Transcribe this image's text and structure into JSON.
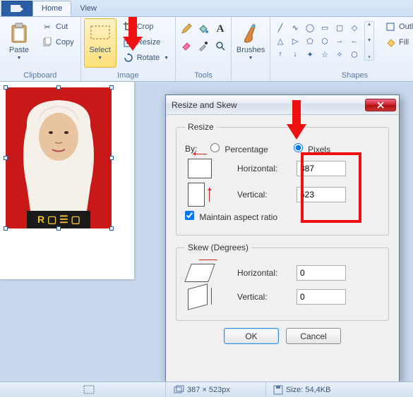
{
  "tabs": {
    "home": "Home",
    "view": "View"
  },
  "ribbon": {
    "clipboard": {
      "label": "Clipboard",
      "paste": "Paste",
      "cut": "Cut",
      "copy": "Copy"
    },
    "image": {
      "label": "Image",
      "select": "Select",
      "crop": "Crop",
      "resize": "Resize",
      "rotate": "Rotate"
    },
    "tools": {
      "label": "Tools"
    },
    "brushes": {
      "label": "Brushes"
    },
    "shapes": {
      "label": "Shapes",
      "outline": "Outline",
      "fill": "Fill"
    }
  },
  "dialog": {
    "title": "Resize and Skew",
    "resize_legend": "Resize",
    "by": "By:",
    "percentage": "Percentage",
    "pixels": "Pixels",
    "horizontal": "Horizontal:",
    "vertical": "Vertical:",
    "h_val": "387",
    "v_val": "523",
    "maintain": "Maintain aspect ratio",
    "skew_legend": "Skew (Degrees)",
    "sh_val": "0",
    "sv_val": "0",
    "ok": "OK",
    "cancel": "Cancel"
  },
  "status": {
    "dims": "387 × 523px",
    "size": "Size: 54,4KB"
  }
}
